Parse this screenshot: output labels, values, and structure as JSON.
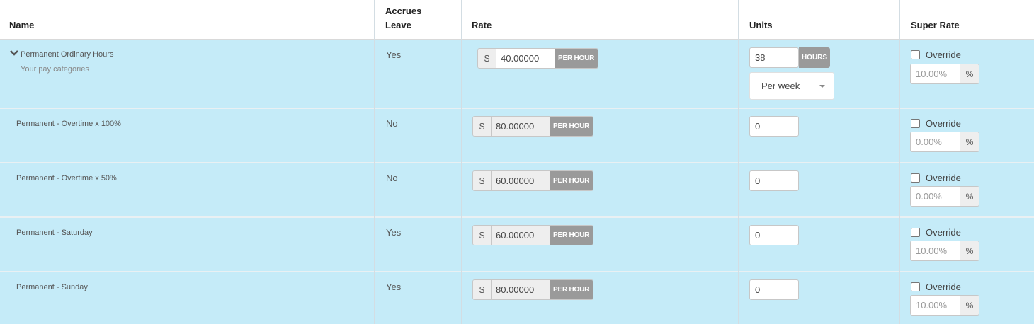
{
  "headers": {
    "name": "Name",
    "accrues_line1": "Accrues",
    "accrues_line2": "Leave",
    "rate": "Rate",
    "units": "Units",
    "super_rate": "Super Rate"
  },
  "currency_symbol": "$",
  "rate_unit": "PER HOUR",
  "hours_unit": "HOURS",
  "override_label": "Override",
  "percent_symbol": "%",
  "rows": [
    {
      "name": "Permanent Ordinary Hours",
      "subtitle": "Your pay categories",
      "accrues": "Yes",
      "rate": "40.00000",
      "units": "38",
      "frequency": "Per week",
      "super_rate_placeholder": "10.00%"
    },
    {
      "name": "Permanent - Overtime x 100%",
      "accrues": "No",
      "rate": "80.00000",
      "units": "0",
      "super_rate_placeholder": "0.00%"
    },
    {
      "name": "Permanent - Overtime x 50%",
      "accrues": "No",
      "rate": "60.00000",
      "units": "0",
      "super_rate_placeholder": "0.00%"
    },
    {
      "name": "Permanent - Saturday",
      "accrues": "Yes",
      "rate": "60.00000",
      "units": "0",
      "super_rate_placeholder": "10.00%"
    },
    {
      "name": "Permanent - Sunday",
      "accrues": "Yes",
      "rate": "80.00000",
      "units": "0",
      "super_rate_placeholder": "10.00%"
    }
  ]
}
